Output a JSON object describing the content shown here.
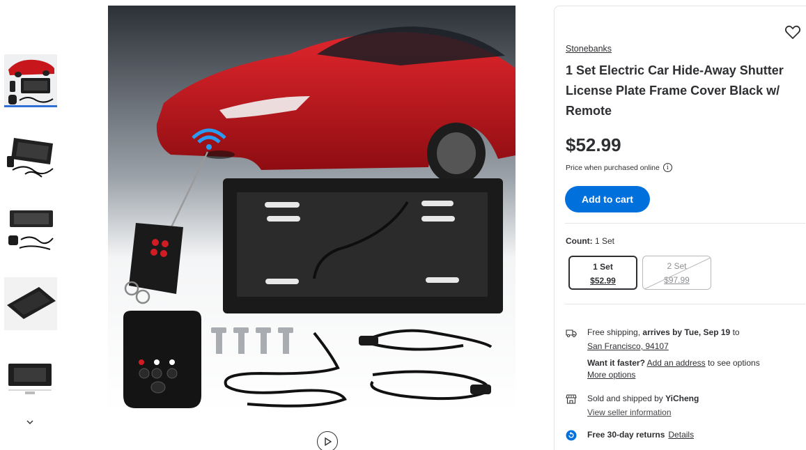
{
  "gallery": {
    "thumbnails": [
      {
        "name": "thumb-1",
        "active": true
      },
      {
        "name": "thumb-2",
        "active": false
      },
      {
        "name": "thumb-3",
        "active": false
      },
      {
        "name": "thumb-4",
        "active": false
      },
      {
        "name": "thumb-5",
        "active": false
      }
    ]
  },
  "product": {
    "brand": "Stonebanks",
    "title": "1 Set Electric Car Hide-Away Shutter License Plate Frame Cover Black w/ Remote",
    "price": "$52.99",
    "price_note": "Price when purchased online",
    "info_glyph": "i",
    "add_to_cart": "Add to cart"
  },
  "count": {
    "label": "Count:",
    "value": "1 Set",
    "options": [
      {
        "name": "1 Set",
        "price": "$52.99",
        "selected": true,
        "available": true
      },
      {
        "name": "2 Set",
        "price": "$97.99",
        "selected": false,
        "available": false
      }
    ]
  },
  "fulfillment": {
    "shipping_prefix": "Free shipping, ",
    "shipping_bold": "arrives by Tue, Sep 19",
    "shipping_suffix": " to",
    "location": "San Francisco, 94107",
    "faster_bold": "Want it faster?",
    "add_address": "Add an address",
    "faster_suffix": " to see options",
    "more_options": "More options",
    "sold_prefix": "Sold and shipped by ",
    "seller": "YiCheng",
    "seller_info": "View seller information",
    "returns": "Free 30-day returns",
    "returns_details": "Details"
  },
  "colors": {
    "primary": "#0071dc",
    "text": "#2e2f32",
    "border": "#e3e4e5",
    "thumb_active": "#2f6fd6"
  },
  "icons": [
    "heart-icon",
    "info-icon",
    "truck-icon",
    "store-icon",
    "returns-icon",
    "play-icon",
    "chevron-down-icon"
  ]
}
